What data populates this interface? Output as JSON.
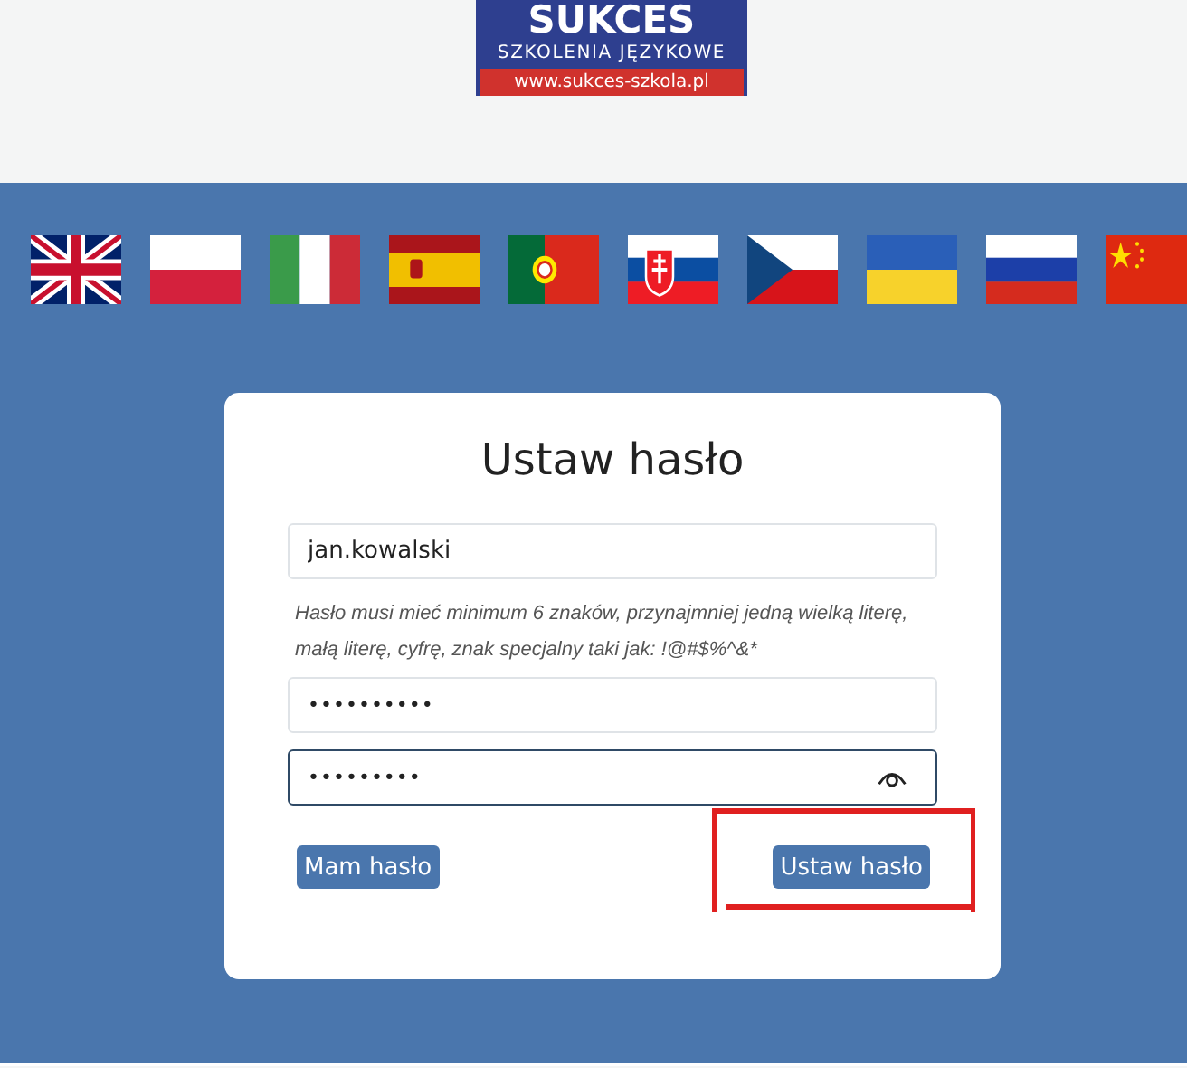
{
  "logo": {
    "name": "SUKCES",
    "tagline": "SZKOLENIA JĘZYKOWE",
    "url": "www.sukces-szkola.pl"
  },
  "form": {
    "title": "Ustaw hasło",
    "fields": [
      {
        "kind": "text",
        "value": "jan.kowalski",
        "focused": false
      },
      {
        "kind": "hint",
        "text": "Hasło musi mieć minimum 6 znaków, przynajmniej jedną wielką literę, małą literę, cyfrę, znak specjalny taki jak: !@#$%^&*"
      },
      {
        "kind": "password",
        "value": "••••••••••",
        "focused": false,
        "reveal": false
      },
      {
        "kind": "password",
        "value": "•••••••••",
        "focused": true,
        "reveal": true
      }
    ],
    "buttons": [
      {
        "label": "Mam hasło",
        "highlighted": false
      },
      {
        "label": "Ustaw hasło",
        "highlighted": true
      }
    ]
  }
}
